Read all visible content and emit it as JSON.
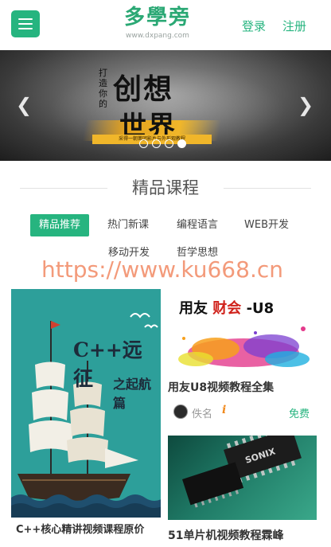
{
  "header": {
    "logo_title": "多學旁",
    "logo_subtitle": "www.dxpang.com",
    "login_label": "登录",
    "register_label": "注册"
  },
  "banner": {
    "vertical_text": "打造你的",
    "line1": "创想",
    "line2": "世界",
    "tagline": "采得一朝菁团影片与外形观教程",
    "dots_total": 4,
    "active_dot": 4,
    "prev_icon": "chevron-left-icon",
    "next_icon": "chevron-right-icon"
  },
  "section": {
    "title": "精品课程",
    "tabs": [
      {
        "label": "精品推荐",
        "active": true
      },
      {
        "label": "热门新课",
        "active": false
      },
      {
        "label": "编程语言",
        "active": false
      },
      {
        "label": "WEB开发",
        "active": false
      },
      {
        "label": "移动开发",
        "active": false
      },
      {
        "label": "哲学思想",
        "active": false
      }
    ]
  },
  "watermark": "https://www.ku668.cn",
  "courses": [
    {
      "image_title": "C++远征",
      "image_subtitle": "之起航篇",
      "title": "C++核心精讲视频课程原价"
    },
    {
      "image_heading_black1": "用友",
      "image_heading_red": "财会",
      "image_heading_black2": "-U8",
      "title": "用友U8视频教程全集",
      "author": "佚名",
      "info_icon": "info-icon",
      "price": "免费"
    },
    {
      "title": "51单片机视频教程霖峰",
      "chip_label": "SONIX"
    }
  ],
  "colors": {
    "accent": "#26b47f",
    "watermark": "#f39a7a"
  }
}
